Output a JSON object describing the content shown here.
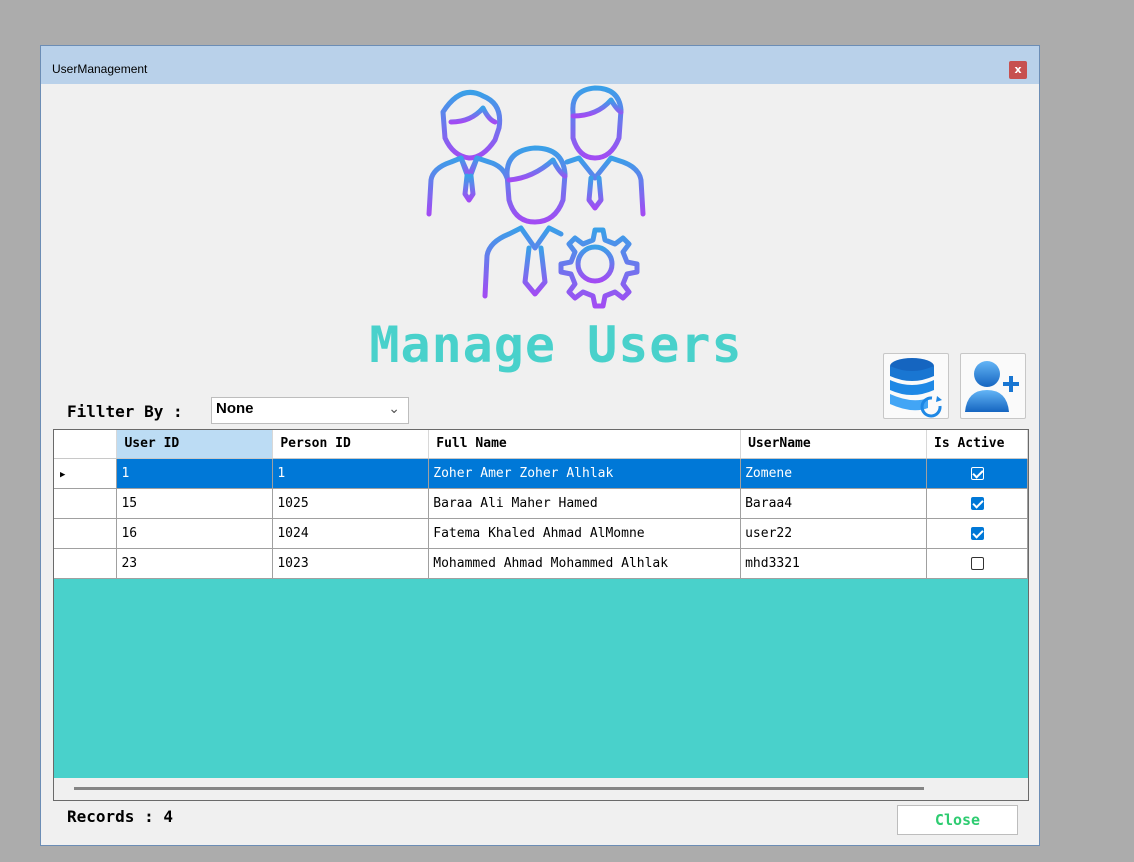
{
  "window": {
    "title": "UserManagement",
    "close_glyph": "x"
  },
  "header": {
    "title": "Manage Users",
    "logo_icon": "users-gear-icon"
  },
  "toolbar": {
    "refresh_icon": "database-refresh-icon",
    "add_icon": "add-user-icon"
  },
  "filter": {
    "label": "Fillter By :",
    "selected": "None"
  },
  "table": {
    "columns": [
      "User ID",
      "Person ID",
      "Full Name",
      "UserName",
      "Is Active"
    ],
    "rows": [
      {
        "user_id": "1",
        "person_id": "1",
        "full_name": "Zoher Amer Zoher Alhlak",
        "username": "Zomene",
        "is_active": true
      },
      {
        "user_id": "15",
        "person_id": "1025",
        "full_name": "Baraa Ali Maher Hamed",
        "username": "Baraa4",
        "is_active": true
      },
      {
        "user_id": "16",
        "person_id": "1024",
        "full_name": "Fatema Khaled Ahmad AlMomne",
        "username": "user22",
        "is_active": true
      },
      {
        "user_id": "23",
        "person_id": "1023",
        "full_name": "Mohammed Ahmad Mohammed Alhlak",
        "username": "mhd3321",
        "is_active": false
      }
    ]
  },
  "footer": {
    "records": "Records : 4",
    "close_label": "Close"
  },
  "colors": {
    "accent": "#49d1cb",
    "selection": "#0078d7",
    "close_text": "#2ecc71",
    "titlebar": "#b9d1ea"
  }
}
